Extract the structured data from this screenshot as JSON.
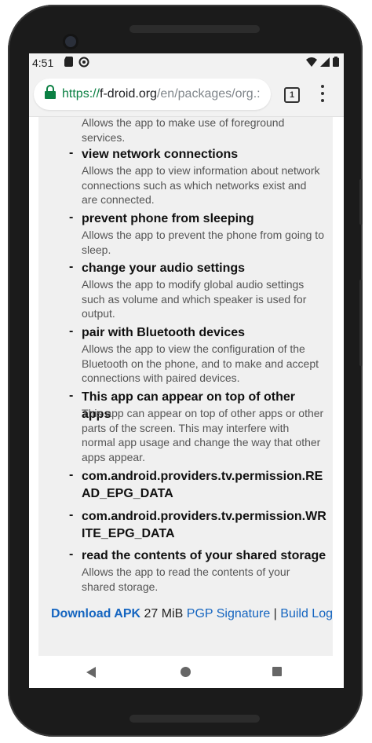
{
  "status_bar": {
    "time": "4:51",
    "icons": [
      "sd-card-icon",
      "sync-icon",
      "wifi-icon",
      "signal-icon",
      "battery-icon"
    ]
  },
  "browser": {
    "url_scheme": "https://",
    "url_domain": "f-droid.org",
    "url_path": "/en/packages/org.:",
    "tab_count": "1",
    "colors": {
      "secure": "#0b8043",
      "link": "#1565c0"
    }
  },
  "permissions": {
    "partial_desc": "Allows the app to make use of foreground services.",
    "items": [
      {
        "title": "view network connections",
        "desc": "Allows the app to view information about network connections such as which networks exist and are connected."
      },
      {
        "title": "prevent phone from sleeping",
        "desc": "Allows the app to prevent the phone from going to sleep."
      },
      {
        "title": "change your audio settings",
        "desc": "Allows the app to modify global audio settings such as volume and which speaker is used for output."
      },
      {
        "title": "pair with Bluetooth devices",
        "desc": "Allows the app to view the configuration of the Bluetooth on the phone, and to make and accept connections with paired devices."
      },
      {
        "title": "This app can appear on top of other apps",
        "desc": "This app can appear on top of other apps or other parts of the screen. This may interfere with normal app usage and change the way that other apps appear."
      },
      {
        "title": "com.android.providers.tv.permission.READ_EPG_DATA",
        "desc": ""
      },
      {
        "title": "com.android.providers.tv.permission.WRITE_EPG_DATA",
        "desc": ""
      },
      {
        "title": "read the contents of your shared storage",
        "desc": "Allows the app to read the contents of your shared storage."
      }
    ]
  },
  "download": {
    "apk_label": "Download APK",
    "size": "27 MiB",
    "pgp_label": "PGP Signature",
    "separator": "|",
    "build_log_label": "Build Log"
  }
}
